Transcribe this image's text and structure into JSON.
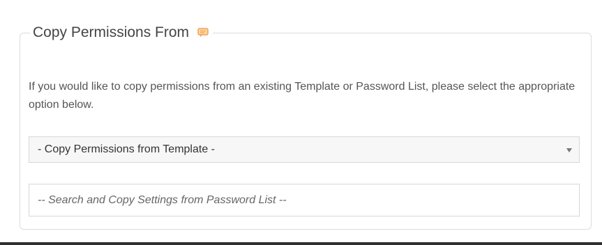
{
  "panel": {
    "title": "Copy Permissions From",
    "help_icon": "comment-help-icon",
    "description": "If you would like to copy permissions from an existing Template or Password List, please select the appropriate option below.",
    "template_select": {
      "selected": "- Copy Permissions from Template -"
    },
    "password_list_search": {
      "placeholder": "-- Search and Copy Settings from Password List --",
      "value": ""
    }
  },
  "colors": {
    "border": "#dcdcdc",
    "help_icon": "#f0a050",
    "select_bg": "#f7f7f7",
    "bottom_bar": "#2f2f2f"
  }
}
